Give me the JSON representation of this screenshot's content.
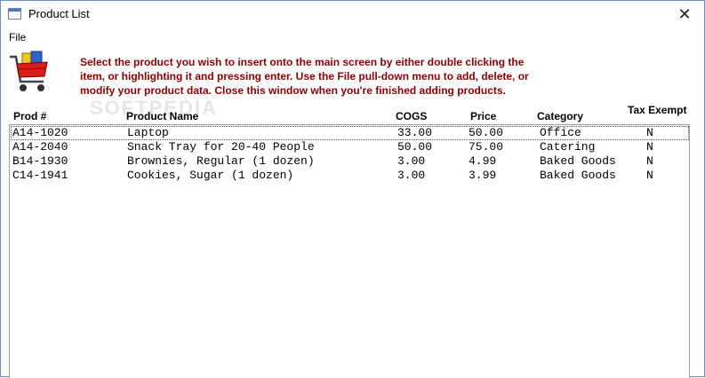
{
  "window": {
    "title": "Product List",
    "close_glyph": "✕"
  },
  "menu": {
    "file_label": "File"
  },
  "icons": {
    "app": "window-icon",
    "cart": "shopping-cart-icon",
    "close": "close-icon"
  },
  "instructions": "Select the product you wish to insert onto the main screen by either double clicking the item, or highlighting it and pressing enter.  Use the File pull-down menu to add, delete, or modify your product data.  Close this window when you're finished adding products.",
  "columns": {
    "prod": "Prod #",
    "name": "Product Name",
    "cogs": "COGS",
    "price": "Price",
    "category": "Category",
    "tax": "Tax Exempt"
  },
  "rows": [
    {
      "prod": "A14-1020",
      "name": "Laptop",
      "cogs": "33.00",
      "price": "50.00",
      "category": "Office",
      "tax": "N"
    },
    {
      "prod": "A14-2040",
      "name": "Snack Tray for 20-40 People",
      "cogs": "50.00",
      "price": "75.00",
      "category": "Catering",
      "tax": "N"
    },
    {
      "prod": "B14-1930",
      "name": "Brownies, Regular (1 dozen)",
      "cogs": "3.00",
      "price": "4.99",
      "category": "Baked Goods",
      "tax": "N"
    },
    {
      "prod": "C14-1941",
      "name": "Cookies, Sugar (1 dozen)",
      "cogs": "3.00",
      "price": "3.99",
      "category": "Baked Goods",
      "tax": "N"
    }
  ],
  "selected_row": 0,
  "colors": {
    "instruction_text": "#8b0000",
    "window_border": "#6d8fbf"
  }
}
